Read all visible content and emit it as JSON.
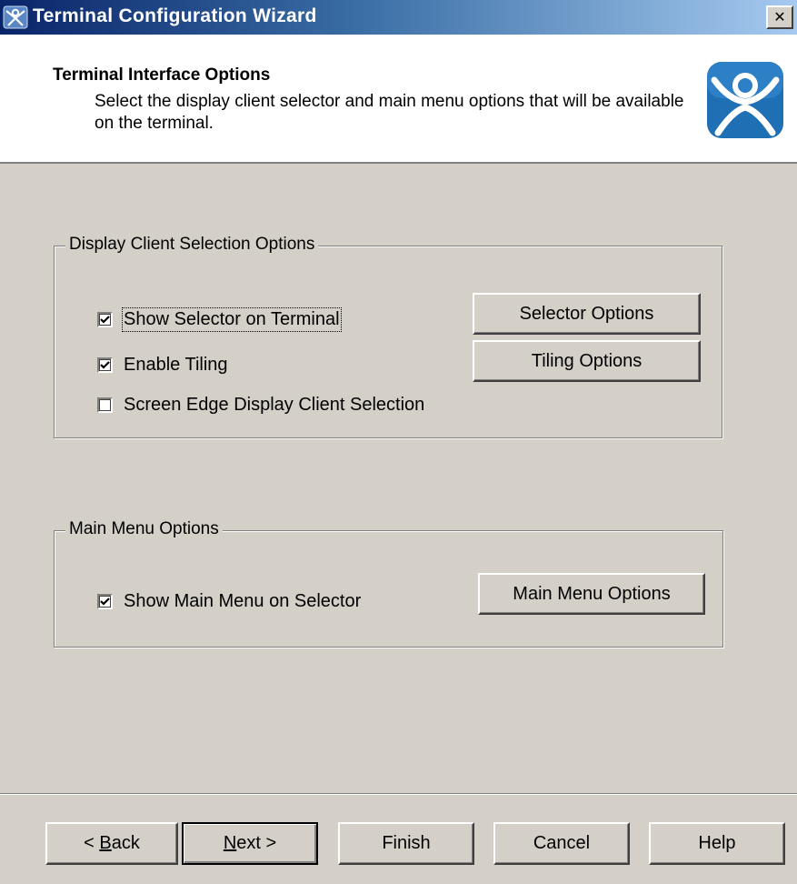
{
  "window": {
    "title": "Terminal Configuration Wizard",
    "close_label": "✕"
  },
  "header": {
    "title": "Terminal Interface Options",
    "description": "Select the display client selector and main menu options that will be available on the terminal."
  },
  "display_group": {
    "legend": "Display Client Selection Options",
    "checkboxes": [
      {
        "label": "Show Selector on Terminal",
        "checked": true
      },
      {
        "label": "Enable Tiling",
        "checked": true
      },
      {
        "label": "Screen Edge Display Client Selection",
        "checked": false
      }
    ],
    "selector_options_label": "Selector Options",
    "tiling_options_label": "Tiling Options"
  },
  "menu_group": {
    "legend": "Main Menu Options",
    "checkboxes": [
      {
        "label": "Show Main Menu on Selector",
        "checked": true
      }
    ],
    "main_menu_options_label": "Main Menu Options"
  },
  "footer": {
    "back_prefix": "< ",
    "back_mnemonic": "B",
    "back_rest": "ack",
    "next_mnemonic": "N",
    "next_rest": "ext >",
    "finish_label": "Finish",
    "cancel_label": "Cancel",
    "help_label": "Help"
  },
  "colors": {
    "titlebar_start": "#0a246a",
    "titlebar_end": "#a6caf0",
    "dialog_bg": "#d4d0c8",
    "logo_blue": "#1f6fb5"
  }
}
